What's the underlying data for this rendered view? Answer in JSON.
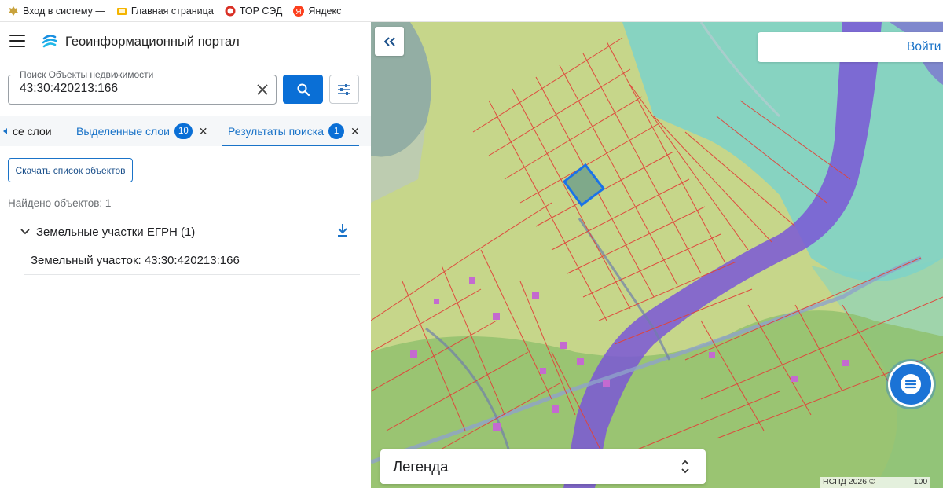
{
  "bookmarks": [
    {
      "label": "Вход в систему —",
      "icon": "emblem-icon",
      "color": "#c8a23c"
    },
    {
      "label": "Главная страница",
      "icon": "folder-icon",
      "color": "#f4b400"
    },
    {
      "label": "ТОР СЭД",
      "icon": "ring-icon",
      "color": "#d93025"
    },
    {
      "label": "Яндекс",
      "icon": "yandex-icon",
      "color": "#fc3f1d"
    }
  ],
  "app": {
    "title": "Геоинформационный портал"
  },
  "search": {
    "legend": "Поиск Объекты недвижимости",
    "value": "43:30:420213:166"
  },
  "tabs": [
    {
      "label": "се слои"
    },
    {
      "label": "Выделенные слои",
      "count": "10"
    },
    {
      "label": "Результаты поиска",
      "count": "1"
    }
  ],
  "results": {
    "download_label": "Скачать список объектов",
    "found_text": "Найдено объектов: 1",
    "group_label": "Земельные участки ЕГРН (1)",
    "item_label": "Земельный участок: 43:30:420213:166"
  },
  "map": {
    "login_label": "Войти",
    "legend_label": "Легенда",
    "copyright": "НСПД 2026 ©",
    "copyright_tail": "100"
  },
  "colors": {
    "accent": "#0a6fd6",
    "parcel_lines": "#e0443a",
    "zone_green": "#c6d68a",
    "zone_teal": "#7fd3c6",
    "zone_purple": "#7a57d6",
    "selected_parcel": "#1a73e8"
  }
}
